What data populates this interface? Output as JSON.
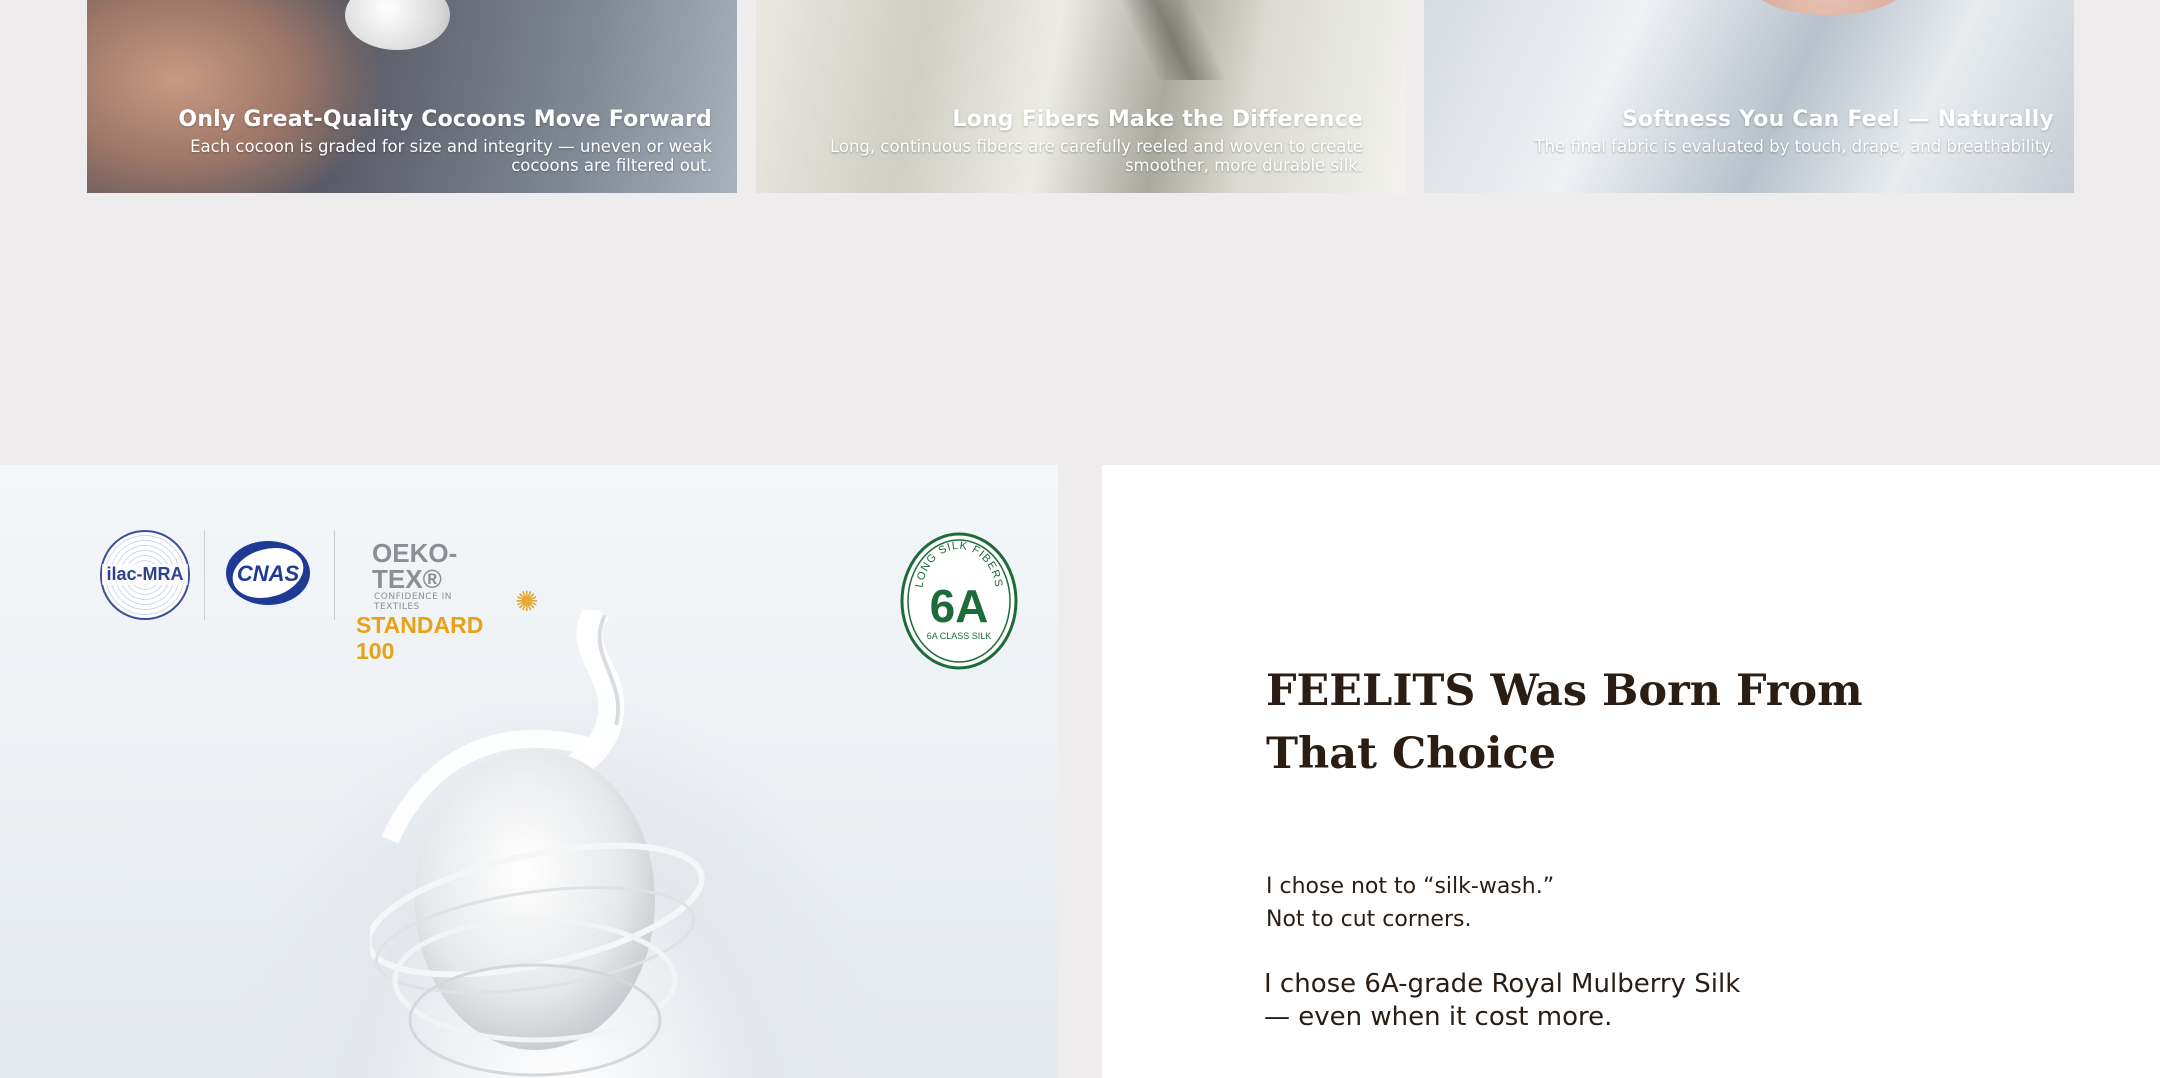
{
  "cards": [
    {
      "title": "Only Great-Quality Cocoons Move Forward",
      "desc_line1": "Each cocoon is graded for size and integrity — uneven or weak",
      "desc_line2": "cocoons are filtered out."
    },
    {
      "title": "Long Fibers Make the Difference",
      "desc_line1": "Long, continuous fibers are carefully reeled and woven to create",
      "desc_line2": "smoother, more durable silk."
    },
    {
      "title": "Softness You Can Feel — Naturally",
      "desc_line1": "The final fabric is evaluated by touch, drape, and breathability.",
      "desc_line2": ""
    }
  ],
  "logos": {
    "ilac": "ilac-MRA",
    "cnas": "CNAS",
    "oeko_line1": "OEKO-TEX®",
    "oeko_line2": "CONFIDENCE IN TEXTILES",
    "oeko_line3": "STANDARD 100",
    "badge_top": "LONG SILK FIBERS",
    "badge_main": "6A",
    "badge_bottom": "6A CLASS SILK"
  },
  "icons": {
    "flower": "oeko-flower-icon"
  },
  "colors": {
    "background": "#efeced",
    "heading": "#2a1d14",
    "badge_green": "#1e6b3a",
    "oeko_orange": "#e8a21a",
    "cnas_blue": "#1f3a93"
  },
  "story": {
    "heading_line1": "FEELITS Was Born From",
    "heading_line2": "That Choice",
    "p1_line1": "I chose not to “silk-wash.”",
    "p1_line2": "Not to cut corners.",
    "p2_line1": "I chose 6A-grade Royal Mulberry Silk",
    "p2_line2": "— even when it cost more.",
    "p3_line1": ""
  }
}
